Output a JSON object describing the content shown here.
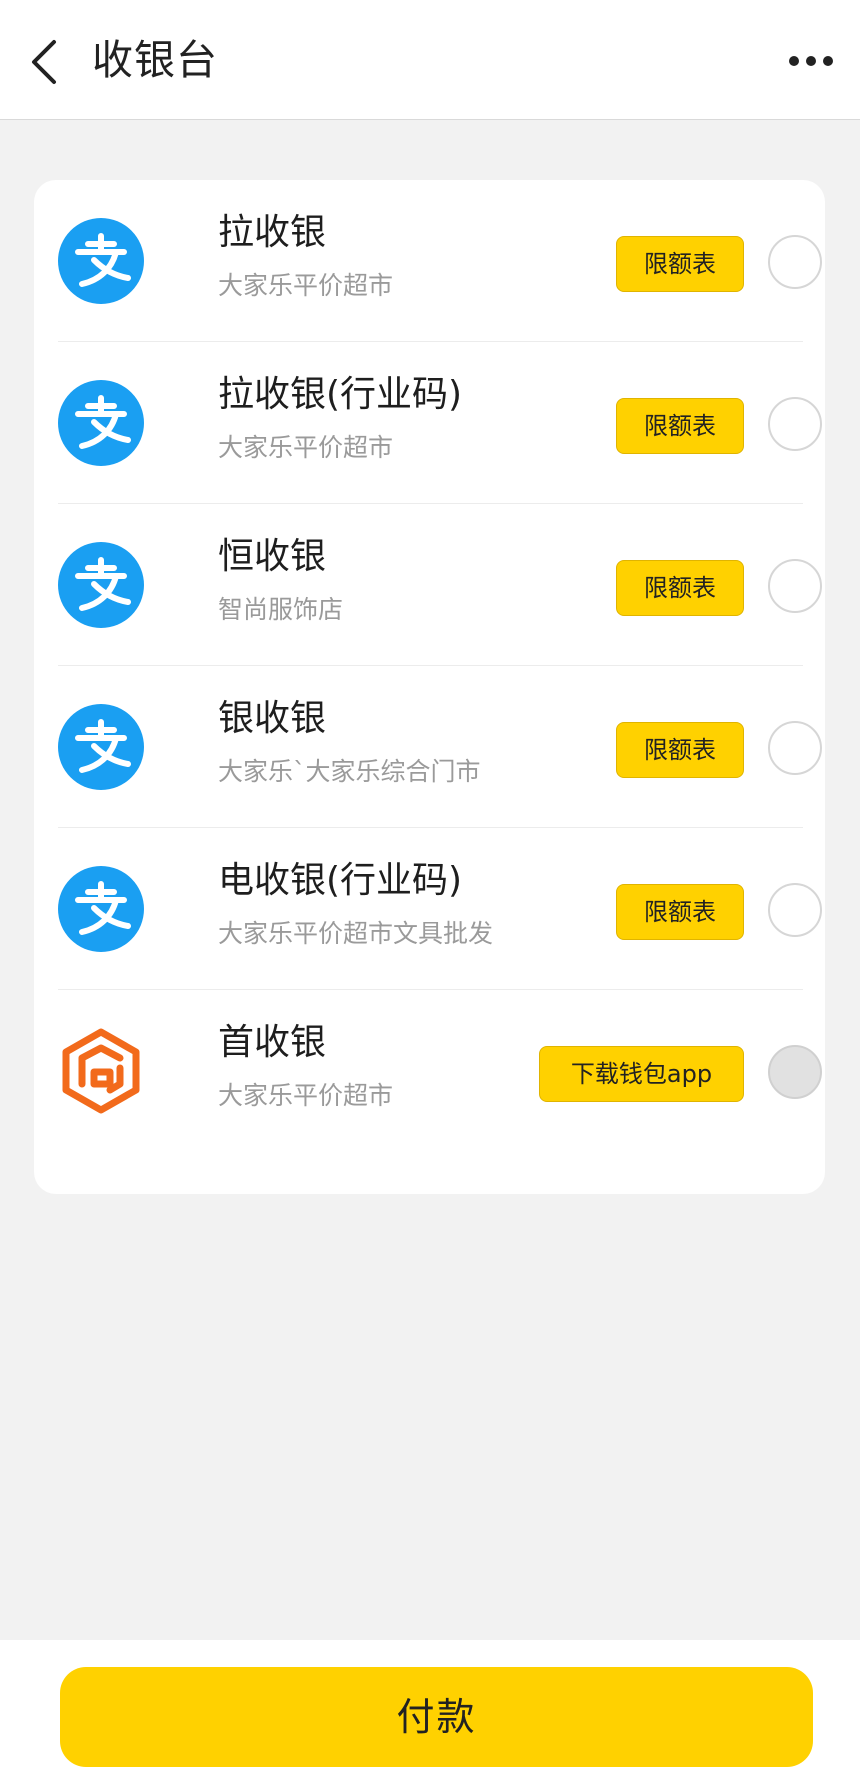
{
  "header": {
    "title": "收银台",
    "back_icon": "chevron-left-icon",
    "more_icon": "more-dots-icon"
  },
  "colors": {
    "accent": "#ffd100",
    "alipay_blue": "#1a9ff2",
    "wallet_orange": "#f26a1b"
  },
  "methods": [
    {
      "name": "拉收银",
      "merchant": "大家乐平价超市",
      "button": "限额表",
      "icon": "alipay-icon"
    },
    {
      "name": "拉收银(行业码)",
      "merchant": "大家乐平价超市",
      "button": "限额表",
      "icon": "alipay-icon"
    },
    {
      "name": "恒收银",
      "merchant": "智尚服饰店",
      "button": "限额表",
      "icon": "alipay-icon"
    },
    {
      "name": "银收银",
      "merchant": "大家乐`大家乐综合门市",
      "button": "限额表",
      "icon": "alipay-icon"
    },
    {
      "name": "电收银(行业码)",
      "merchant": "大家乐平价超市文具批发",
      "button": "限额表",
      "icon": "alipay-icon"
    },
    {
      "name": "首收银",
      "merchant": "大家乐平价超市",
      "button": "下载钱包app",
      "icon": "wallet-app-icon"
    }
  ],
  "footer": {
    "pay_label": "付款"
  }
}
